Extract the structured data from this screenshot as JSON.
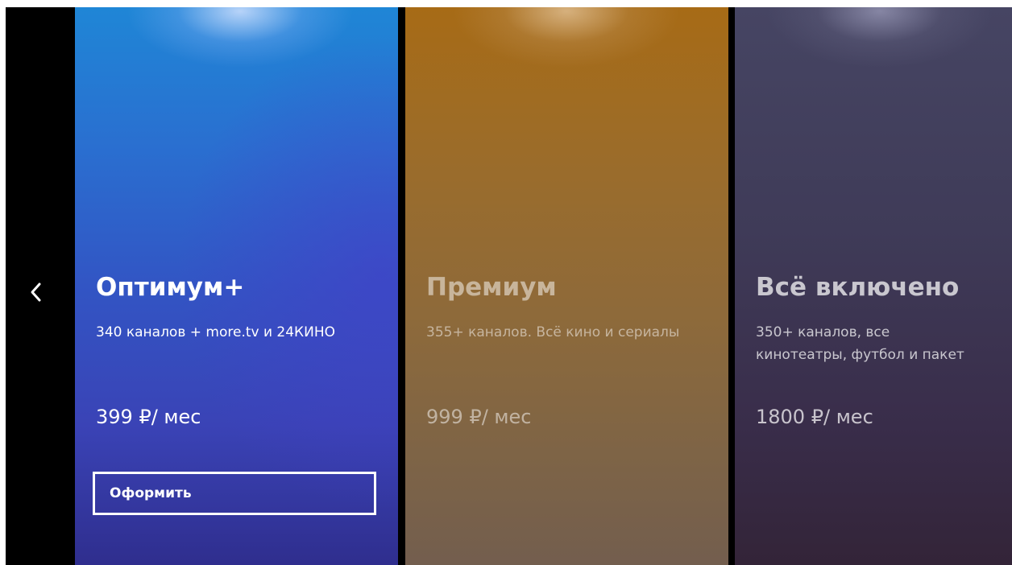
{
  "navigation": {
    "back_icon": "chevron-left-icon"
  },
  "plans": [
    {
      "title": "Оптимум+",
      "description": "340 каналов + more.tv и 24КИНО",
      "price": "399 ₽/ мес",
      "button_label": "Оформить",
      "state": "focused",
      "accent": "#3255c4"
    },
    {
      "title": "Премиум",
      "description": "355+ каналов. Всё кино и сериалы",
      "price": "999 ₽/ мес",
      "state": "inactive",
      "accent": "#9a6c2c"
    },
    {
      "title": "Всё включено",
      "description": "350+ каналов, все\nкинотеатры, футбол и пакет",
      "price": "1800 ₽/ мес",
      "state": "inactive",
      "accent": "#3f3b58"
    }
  ]
}
